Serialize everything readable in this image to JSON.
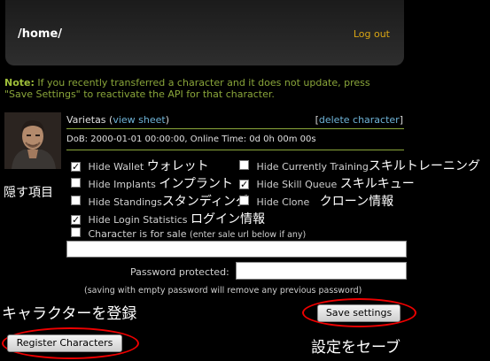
{
  "header": {
    "path": "/home/",
    "logout": "Log out"
  },
  "note": {
    "label": "Note:",
    "text": " If you recently transferred a character and it does not update, press \"Save Settings\" to reactivate the API for that character."
  },
  "avatar_label": "隠す項目",
  "character": {
    "name": "Varietas",
    "view_sheet": "view sheet",
    "delete": "delete character",
    "dob_line": "DoB: 2000-01-01 00:00:00, Online Time: 0d 0h 00m 00s"
  },
  "options": {
    "hide_wallet": {
      "label": "Hide Wallet",
      "jp": "ウォレット",
      "checked": true
    },
    "hide_training": {
      "label": "Hide Currently Training",
      "jp": "スキルトレーニング",
      "checked": false
    },
    "hide_implants": {
      "label": "Hide Implants",
      "jp": "インプラント",
      "checked": false
    },
    "hide_skill_queue": {
      "label": "Hide Skill Queue",
      "jp": "スキルキュー",
      "checked": true
    },
    "hide_standings": {
      "label": "Hide Standings",
      "jp": "スタンディング",
      "checked": false
    },
    "hide_clone": {
      "label": "Hide Clone",
      "jp": "クローン情報",
      "checked": false
    },
    "hide_login_stats": {
      "label": "Hide Login Statistics",
      "jp": "ログイン情報",
      "checked": true
    },
    "for_sale": {
      "label": "Character is for sale",
      "hint": "(enter sale url below if any)",
      "checked": false
    }
  },
  "sale_url": {
    "value": ""
  },
  "password": {
    "label": "Password protected:",
    "value": "",
    "note": "(saving with empty password will remove any previous password)"
  },
  "buttons": {
    "save": "Save settings",
    "register": "Register Characters"
  },
  "annotations": {
    "register": "キャラクターを登録",
    "save": "設定をセーブ"
  }
}
